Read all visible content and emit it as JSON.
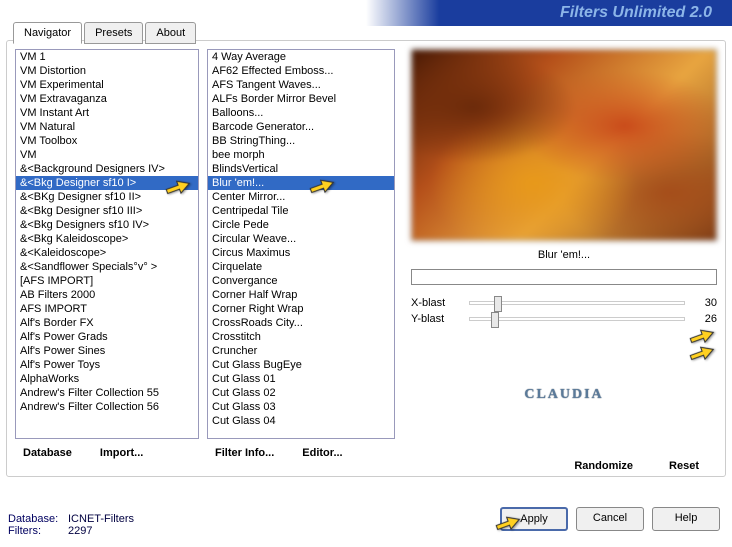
{
  "title": "Filters Unlimited 2.0",
  "tabs": [
    "Navigator",
    "Presets",
    "About"
  ],
  "activeTab": 0,
  "categories": [
    "VM 1",
    "VM Distortion",
    "VM Experimental",
    "VM Extravaganza",
    "VM Instant Art",
    "VM Natural",
    "VM Toolbox",
    "VM",
    "&<Background Designers IV>",
    "&<Bkg Designer sf10 I>",
    "&<BKg Designer sf10 II>",
    "&<Bkg Designer sf10 III>",
    "&<Bkg Designers sf10 IV>",
    "&<Bkg Kaleidoscope>",
    "&<Kaleidoscope>",
    "&<Sandflower Specials°v° >",
    "[AFS IMPORT]",
    "AB Filters 2000",
    "AFS IMPORT",
    "Alf's Border FX",
    "Alf's Power Grads",
    "Alf's Power Sines",
    "Alf's Power Toys",
    "AlphaWorks",
    "Andrew's Filter Collection 55",
    "Andrew's Filter Collection 56"
  ],
  "selectedCategory": 9,
  "filters": [
    "4 Way Average",
    "AF62 Effected Emboss...",
    "AFS Tangent Waves...",
    "ALFs Border Mirror Bevel",
    "Balloons...",
    "Barcode Generator...",
    "BB StringThing...",
    "bee morph",
    "BlindsVertical",
    "Blur 'em!...",
    "Center Mirror...",
    "Centripedal Tile",
    "Circle Pede",
    "Circular Weave...",
    "Circus Maximus",
    "Cirquelate",
    "Convergance",
    "Corner Half Wrap",
    "Corner Right Wrap",
    "CrossRoads City...",
    "Crosstitch",
    "Cruncher",
    "Cut Glass  BugEye",
    "Cut Glass 01",
    "Cut Glass 02",
    "Cut Glass 03",
    "Cut Glass 04"
  ],
  "selectedFilter": 9,
  "currentFilterName": "Blur 'em!...",
  "sliders": [
    {
      "label": "X-blast",
      "value": 30,
      "pct": 11
    },
    {
      "label": "Y-blast",
      "value": 26,
      "pct": 10
    }
  ],
  "buttons": {
    "database": "Database",
    "import": "Import...",
    "filterInfo": "Filter Info...",
    "editor": "Editor...",
    "randomize": "Randomize",
    "reset": "Reset",
    "apply": "Apply",
    "cancel": "Cancel",
    "help": "Help"
  },
  "info": {
    "dbLabel": "Database:",
    "dbValue": "ICNET-Filters",
    "filtersLabel": "Filters:",
    "filtersValue": "2297"
  },
  "logo": "CLAUDIA"
}
